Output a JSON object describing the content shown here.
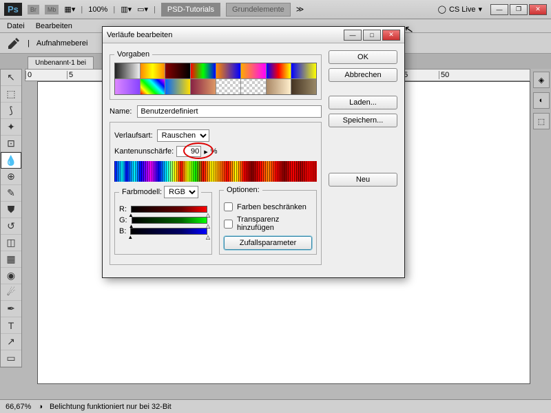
{
  "menubar": {
    "zoom": "100%",
    "tab1": "PSD-Tutorials",
    "tab2": "Grundelemente",
    "cslive": "CS Live"
  },
  "filemenu": {
    "file": "Datei",
    "edit": "Bearbeiten"
  },
  "optbar": {
    "sample": "Aufnahmeberei"
  },
  "doc": {
    "tab": "Unbenannt-1 bei"
  },
  "status": {
    "zoom": "66,67%",
    "msg": "Belichtung funktioniert nur bei 32-Bit"
  },
  "dialog": {
    "title": "Verläufe bearbeiten",
    "presets_legend": "Vorgaben",
    "ok": "OK",
    "cancel": "Abbrechen",
    "load": "Laden...",
    "save": "Speichern...",
    "new": "Neu",
    "name_label": "Name:",
    "name_value": "Benutzerdefiniert",
    "type_label": "Verlaufsart:",
    "type_value": "Rauschen",
    "rough_label": "Kantenunschärfe:",
    "rough_value": "90",
    "rough_unit": "%",
    "colormodel_legend": "Farbmodell:",
    "colormodel_value": "RGB",
    "r": "R:",
    "g": "G:",
    "b": "B:",
    "options_legend": "Optionen:",
    "restrict": "Farben beschränken",
    "transparency": "Transparenz hinzufügen",
    "randomize": "Zufallsparameter"
  },
  "presets": [
    "linear-gradient(90deg,#222,#eee)",
    "linear-gradient(90deg,#f80,#ff0,#f80)",
    "linear-gradient(90deg,#800,#000)",
    "linear-gradient(90deg,#f00,#0f0,#00f)",
    "linear-gradient(90deg,#f80,#00f)",
    "linear-gradient(90deg,#fa0,#f0f)",
    "linear-gradient(90deg,#00f,#f00,#ff0)",
    "linear-gradient(90deg,#00f,#ff0)",
    "linear-gradient(90deg,#d8f,#84f)",
    "linear-gradient(45deg,#f00,#ff0,#0f0,#0ff,#00f,#f0f)",
    "linear-gradient(90deg,#06f,#fd0)",
    "linear-gradient(90deg,#824,#d96)",
    "repeating-conic-gradient(#ccc 0 25%,#fff 0 50%) 0/8px 8px",
    "repeating-conic-gradient(#ccc 0 25%,#fff 0 50%) 0/8px 8px",
    "linear-gradient(90deg,#a86,#fec)",
    "linear-gradient(90deg,#432,#986)"
  ]
}
